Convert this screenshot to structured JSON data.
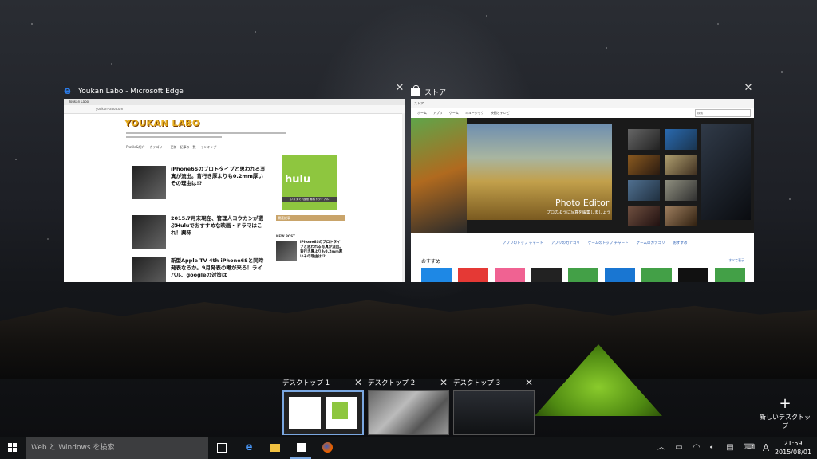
{
  "windows": {
    "edge": {
      "title": "Youkan Labo - Microsoft Edge",
      "tab": "Youkan Labo",
      "url": "youkan-labo.com",
      "logo": "YOUKAN LABO",
      "nav": [
        "Profile&紹介",
        "カテゴリー",
        "更新・記事の一覧",
        "ランキング"
      ],
      "articles": [
        "iPhone6Sのプロトタイプと思われる写真が流出。背行き厚よりも0.2mm厚いその理由は!?",
        "2015.7月末現在、管理人ヨウカンが選ぶHuluでおすすめな映画・ドラマはこれ！興味",
        "新型Apple TV 4th iPhone6Sと同時発表なるか。9月発表の噂が来る！ライバル、googleの対策は"
      ],
      "ad_text": "hulu",
      "ad_bar": "いますぐ2週間 無料トライアル",
      "side_head": "関連記事",
      "new_post": "NEW POST",
      "side_article": "iPhone6Sのプロトタイプと思われる写真が流出。背行き厚よりも0.2mm厚いその理由は!?"
    },
    "store": {
      "title": "ストア",
      "top": "ストア",
      "nav": [
        "ホーム",
        "アプリ",
        "ゲーム",
        "ミュージック",
        "映画とテレビ"
      ],
      "search_placeholder": "検索",
      "hero_title": "Photo Editor",
      "hero_sub": "プロのように写真を編集しましょう",
      "links": [
        "アプリのトップ チャート",
        "アプリのカテゴリ",
        "ゲームのトップ チャート",
        "ゲームのカテゴリ",
        "おすすめ"
      ],
      "recommended": "おすすめ",
      "show_all": "すべて表示"
    }
  },
  "desktops": [
    {
      "label": "デスクトップ 1",
      "active": true
    },
    {
      "label": "デスクトップ 2",
      "active": false
    },
    {
      "label": "デスクトップ 3",
      "active": false
    }
  ],
  "new_desktop": "新しいデスクトップ",
  "taskbar": {
    "search_placeholder": "Web と Windows を検索",
    "ime": "A",
    "time": "21:59",
    "date": "2015/08/01"
  },
  "colors": {
    "accent": "#7aa7e0",
    "edge_blue": "#2b7be8",
    "hulu_green": "#8ec63f",
    "tent_green": "#8acb2c"
  }
}
